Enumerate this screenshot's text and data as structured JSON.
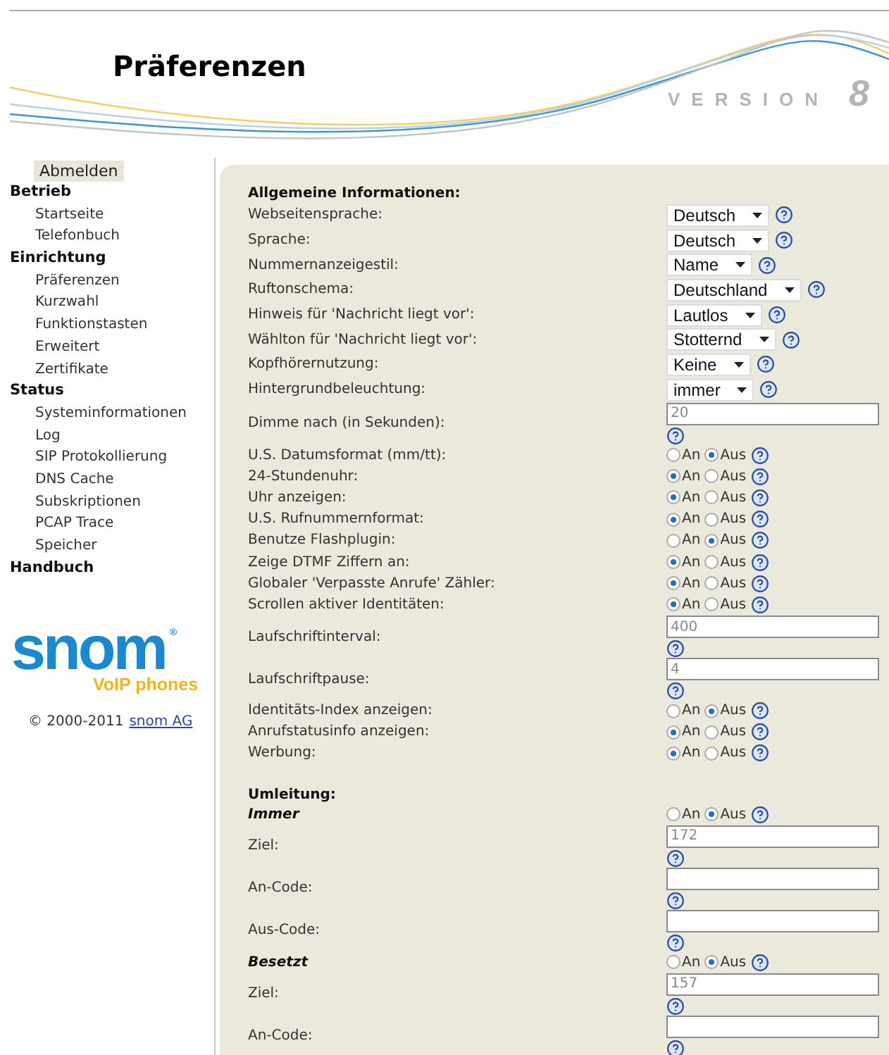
{
  "header": {
    "title": "Präferenzen",
    "version_label": "VERSION",
    "version_number": "8"
  },
  "sidebar": {
    "logout": "Abmelden",
    "groups": [
      {
        "title": "Betrieb",
        "items": [
          "Startseite",
          "Telefonbuch"
        ]
      },
      {
        "title": "Einrichtung",
        "items": [
          "Präferenzen",
          "Kurzwahl",
          "Funktionstasten",
          "Erweitert",
          "Zertifikate"
        ]
      },
      {
        "title": "Status",
        "items": [
          "Systeminformationen",
          "Log",
          "SIP Protokollierung",
          "DNS Cache",
          "Subskriptionen",
          "PCAP Trace",
          "Speicher"
        ]
      },
      {
        "title": "Handbuch"
      }
    ],
    "logo": {
      "name": "snom",
      "mark": "®",
      "tagline": "VoIP phones"
    },
    "copyright": "© 2000-2011",
    "copyright_link": "snom AG"
  },
  "sections": [
    {
      "title": "Allgemeine Informationen:",
      "rows": [
        {
          "kind": "select",
          "label": "Webseitensprache:",
          "value": "Deutsch"
        },
        {
          "kind": "select",
          "label": "Sprache:",
          "value": "Deutsch"
        },
        {
          "kind": "select",
          "label": "Nummernanzeigestil:",
          "value": "Name"
        },
        {
          "kind": "select",
          "label": "Ruftonschema:",
          "value": "Deutschland"
        },
        {
          "kind": "select",
          "label": "Hinweis für 'Nachricht liegt vor':",
          "value": "Lautlos"
        },
        {
          "kind": "select",
          "label": "Wählton für 'Nachricht liegt vor':",
          "value": "Stotternd"
        },
        {
          "kind": "select",
          "label": "Kopfhörernutzung:",
          "value": "Keine"
        },
        {
          "kind": "select",
          "label": "Hintergrundbeleuchtung:",
          "value": "immer"
        },
        {
          "kind": "text",
          "label": "Dimme nach (in Sekunden):",
          "value": "20"
        },
        {
          "kind": "radio",
          "label": "U.S. Datumsformat (mm/tt):",
          "options": [
            {
              "label": "An",
              "selected": false
            },
            {
              "label": "Aus",
              "selected": true
            }
          ]
        },
        {
          "kind": "radio",
          "label": "24-Stundenuhr:",
          "options": [
            {
              "label": "An",
              "selected": true
            },
            {
              "label": "Aus",
              "selected": false
            }
          ]
        },
        {
          "kind": "radio",
          "label": "Uhr anzeigen:",
          "options": [
            {
              "label": "An",
              "selected": true
            },
            {
              "label": "Aus",
              "selected": false
            }
          ]
        },
        {
          "kind": "radio",
          "label": "U.S. Rufnummernformat:",
          "options": [
            {
              "label": "An",
              "selected": true
            },
            {
              "label": "Aus",
              "selected": false
            }
          ]
        },
        {
          "kind": "radio",
          "label": "Benutze Flashplugin:",
          "options": [
            {
              "label": "An",
              "selected": false
            },
            {
              "label": "Aus",
              "selected": true
            }
          ]
        },
        {
          "kind": "radio",
          "label": "Zeige DTMF Ziffern an:",
          "options": [
            {
              "label": "An",
              "selected": true
            },
            {
              "label": "Aus",
              "selected": false
            }
          ]
        },
        {
          "kind": "radio",
          "label": "Globaler 'Verpasste Anrufe' Zähler:",
          "options": [
            {
              "label": "An",
              "selected": true
            },
            {
              "label": "Aus",
              "selected": false
            }
          ]
        },
        {
          "kind": "radio",
          "label": "Scrollen aktiver Identitäten:",
          "options": [
            {
              "label": "An",
              "selected": true
            },
            {
              "label": "Aus",
              "selected": false
            }
          ]
        },
        {
          "kind": "text",
          "label": "Laufschriftinterval:",
          "value": "400"
        },
        {
          "kind": "text",
          "label": "Laufschriftpause:",
          "value": "4"
        },
        {
          "kind": "radio",
          "label": "Identitäts-Index anzeigen:",
          "options": [
            {
              "label": "An",
              "selected": false
            },
            {
              "label": "Aus",
              "selected": true
            }
          ]
        },
        {
          "kind": "radio",
          "label": "Anrufstatusinfo anzeigen:",
          "options": [
            {
              "label": "An",
              "selected": true
            },
            {
              "label": "Aus",
              "selected": false
            }
          ]
        },
        {
          "kind": "radio",
          "label": "Werbung:",
          "options": [
            {
              "label": "An",
              "selected": true
            },
            {
              "label": "Aus",
              "selected": false
            }
          ]
        }
      ]
    },
    {
      "title": "Umleitung:",
      "rows": [
        {
          "kind": "group",
          "label": "Immer",
          "options": [
            {
              "label": "An",
              "selected": false
            },
            {
              "label": "Aus",
              "selected": true
            }
          ]
        },
        {
          "kind": "text",
          "label": "Ziel:",
          "value": "172"
        },
        {
          "kind": "text",
          "label": "An-Code:"
        },
        {
          "kind": "text",
          "label": "Aus-Code:"
        },
        {
          "kind": "group",
          "label": "Besetzt",
          "options": [
            {
              "label": "An",
              "selected": false
            },
            {
              "label": "Aus",
              "selected": true
            }
          ]
        },
        {
          "kind": "text",
          "label": "Ziel:",
          "value": "157"
        },
        {
          "kind": "text",
          "label": "An-Code:"
        }
      ]
    }
  ]
}
